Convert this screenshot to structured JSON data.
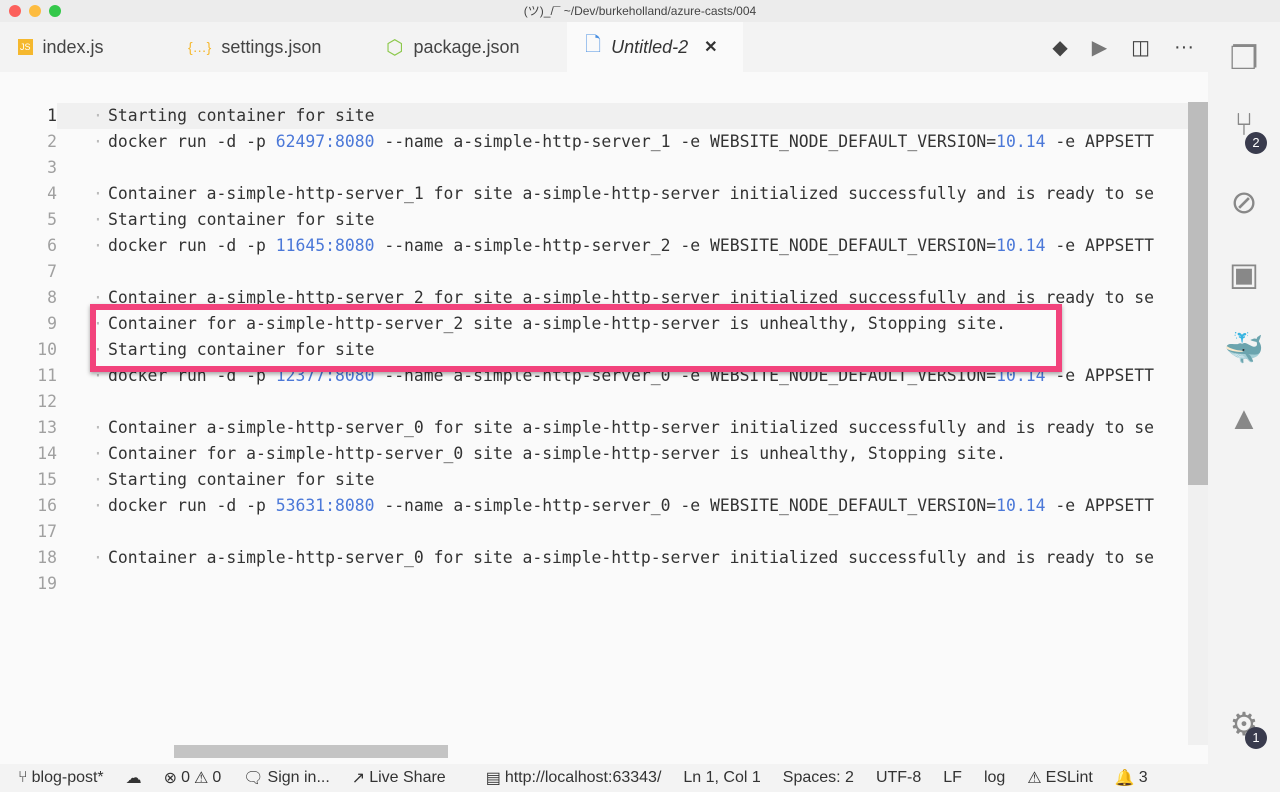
{
  "window": {
    "title": "(ツ)_/¯ ~/Dev/burkeholland/azure-casts/004"
  },
  "tabs": [
    {
      "label": "index.js",
      "icon": "js-file-icon",
      "glyph": "JS",
      "color": "#f5b82e"
    },
    {
      "label": "settings.json",
      "icon": "json-file-icon",
      "glyph": "{…}",
      "color": "#f5b82e"
    },
    {
      "label": "package.json",
      "icon": "node-file-icon",
      "glyph": "⬡",
      "color": "#8cc84b"
    },
    {
      "label": "Untitled-2",
      "icon": "file-icon",
      "glyph": "🗋",
      "color": "#4a90e2",
      "active": true,
      "close": "✕"
    }
  ],
  "editor": {
    "current_line": 1,
    "lines": [
      [
        [
          "Starting container for site",
          ""
        ]
      ],
      [
        [
          "docker run -d -p ",
          ""
        ],
        [
          "62497:8080",
          "num"
        ],
        [
          " --name a-simple-http-server_1 -e WEBSITE_NODE_DEFAULT_VERSION=",
          ""
        ],
        [
          "10.14",
          "num"
        ],
        [
          " -e APPSETT",
          ""
        ]
      ],
      [],
      [
        [
          "Container a-simple-http-server_1 for site a-simple-http-server initialized successfully and is ready to se",
          ""
        ]
      ],
      [
        [
          "Starting container for site",
          ""
        ]
      ],
      [
        [
          "docker run -d -p ",
          ""
        ],
        [
          "11645:8080",
          "num"
        ],
        [
          " --name a-simple-http-server_2 -e WEBSITE_NODE_DEFAULT_VERSION=",
          ""
        ],
        [
          "10.14",
          "num"
        ],
        [
          " -e APPSETT",
          ""
        ]
      ],
      [],
      [
        [
          "Container a-simple-http-server_2 for site a-simple-http-server initialized successfully and is ready to se",
          ""
        ]
      ],
      [
        [
          "Container for a-simple-http-server_2 site a-simple-http-server is unhealthy, Stopping site.",
          ""
        ]
      ],
      [
        [
          "Starting container for site",
          ""
        ]
      ],
      [
        [
          "docker run -d -p ",
          ""
        ],
        [
          "12377:8080",
          "num"
        ],
        [
          " --name a-simple-http-server_0 -e WEBSITE_NODE_DEFAULT_VERSION=",
          ""
        ],
        [
          "10.14",
          "num"
        ],
        [
          " -e APPSETT",
          ""
        ]
      ],
      [],
      [
        [
          "Container a-simple-http-server_0 for site a-simple-http-server initialized successfully and is ready to se",
          ""
        ]
      ],
      [
        [
          "Container for a-simple-http-server_0 site a-simple-http-server is unhealthy, Stopping site.",
          ""
        ]
      ],
      [
        [
          "Starting container for site",
          ""
        ]
      ],
      [
        [
          "docker run -d -p ",
          ""
        ],
        [
          "53631:8080",
          "num"
        ],
        [
          " --name a-simple-http-server_0 -e WEBSITE_NODE_DEFAULT_VERSION=",
          ""
        ],
        [
          "10.14",
          "num"
        ],
        [
          " -e APPSETT",
          ""
        ]
      ],
      [],
      [
        [
          "Container a-simple-http-server_0 for site a-simple-http-server initialized successfully and is ready to se",
          ""
        ]
      ],
      []
    ],
    "highlighted_lines": [
      9,
      10
    ],
    "highlight_color": "#f2437c"
  },
  "activity": {
    "source_control_badge": "2",
    "settings_badge": "1"
  },
  "status": {
    "branch": "blog-post*",
    "errors": "0",
    "warnings": "0",
    "sign_in": "Sign in...",
    "live_share": "Live Share",
    "server": "http://localhost:63343/",
    "position": "Ln 1, Col 1",
    "spaces": "Spaces: 2",
    "encoding": "UTF-8",
    "eol": "LF",
    "language": "log",
    "eslint": "ESLint",
    "notifications": "3"
  }
}
